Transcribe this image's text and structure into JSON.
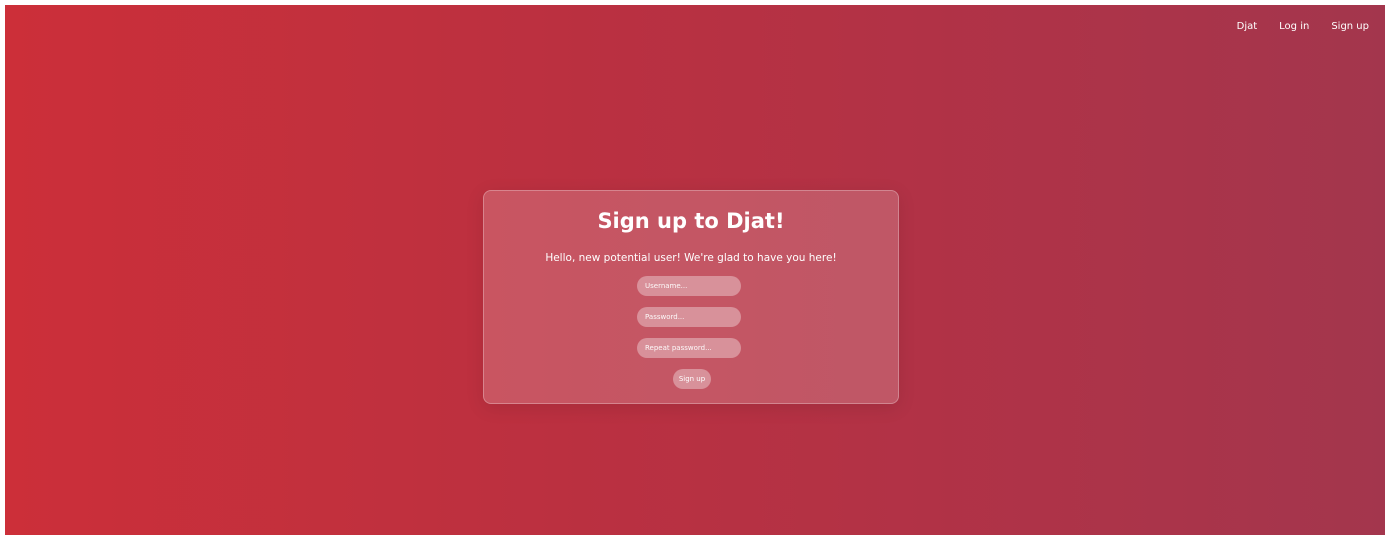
{
  "nav": {
    "items": [
      {
        "label": "Djat"
      },
      {
        "label": "Log in"
      },
      {
        "label": "Sign up"
      }
    ]
  },
  "card": {
    "title": "Sign up to Djat!",
    "subtitle": "Hello, new potential user! We're glad to have you here!",
    "username_placeholder": "Username...",
    "password_placeholder": "Password...",
    "repeat_password_placeholder": "Repeat password...",
    "submit_label": "Sign up"
  },
  "colors": {
    "gradient_start": "#cc2f39",
    "gradient_end": "#a3364d",
    "text": "#ffffff"
  }
}
